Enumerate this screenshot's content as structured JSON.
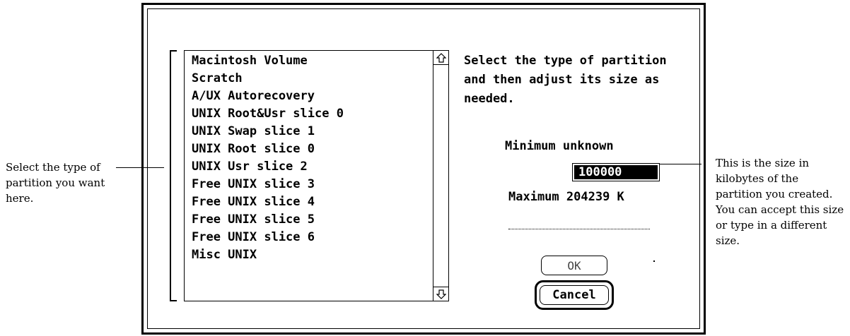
{
  "dialog": {
    "partition_types": [
      "Macintosh Volume",
      "Scratch",
      "A/UX Autorecovery",
      "UNIX Root&Usr slice 0",
      "UNIX Swap slice 1",
      "UNIX Root slice 0",
      "UNIX Usr slice 2",
      "Free UNIX slice 3",
      "Free UNIX slice 4",
      "Free UNIX slice 5",
      "Free UNIX slice 6",
      "Misc UNIX"
    ],
    "instructions": "Select the type of partition and then adjust its size as needed.",
    "minimum_label": "Minimum",
    "minimum_value": "unknown",
    "size_value": "100000",
    "maximum_label": "Maximum",
    "maximum_value": "204239 K",
    "ok_label": "OK",
    "cancel_label": "Cancel"
  },
  "callouts": {
    "left": "Select the type of partition you want here.",
    "right": "This is the size in kilobytes of the partition you created. You can accept this size or type in a different size."
  },
  "icons": {
    "scroll_up": "up-arrow-icon",
    "scroll_down": "down-arrow-icon"
  }
}
